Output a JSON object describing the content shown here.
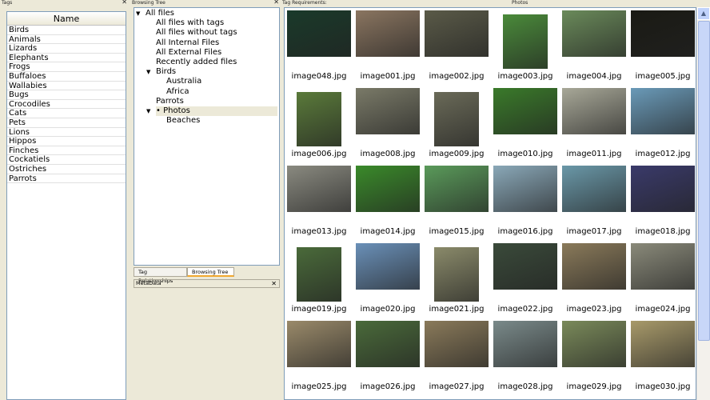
{
  "tags_panel": {
    "title": "Tags",
    "column_header": "Name",
    "items": [
      "Birds",
      "Animals",
      "Lizards",
      "Elephants",
      "Frogs",
      "Buffaloes",
      "Wallabies",
      "Bugs",
      "Crocodiles",
      "Cats",
      "Pets",
      "Lions",
      "Hippos",
      "Finches",
      "Cockatiels",
      "Ostriches",
      "Parrots"
    ]
  },
  "browse_panel": {
    "title": "Browsing Tree",
    "tree": [
      {
        "label": "All files",
        "level": 0,
        "expanded": true
      },
      {
        "label": "All files with tags",
        "level": 1
      },
      {
        "label": "All files without tags",
        "level": 1
      },
      {
        "label": "All Internal Files",
        "level": 1
      },
      {
        "label": "All External Files",
        "level": 1
      },
      {
        "label": "Recently added files",
        "level": 1
      },
      {
        "label": "Birds",
        "level": 1,
        "expanded": true
      },
      {
        "label": "Australia",
        "level": 2
      },
      {
        "label": "Africa",
        "level": 2
      },
      {
        "label": "Parrots",
        "level": 1
      },
      {
        "label": "• Photos",
        "level": 1,
        "expanded": true,
        "selected": true
      },
      {
        "label": "Beaches",
        "level": 2
      }
    ],
    "tabs": [
      "Tag Relationships",
      "Browsing Tree"
    ],
    "active_tab": "Browsing Tree"
  },
  "metadata_panel": {
    "title": "MetaData"
  },
  "photos_panel": {
    "title_left": "Tag Requirements:",
    "title_center": "Photos",
    "images": [
      {
        "name": "image048.jpg",
        "color": "#1a3a2a"
      },
      {
        "name": "image001.jpg",
        "color": "#8a7560"
      },
      {
        "name": "image002.jpg",
        "color": "#5a5a48"
      },
      {
        "name": "image003.jpg",
        "color": "#4a8a3a",
        "portrait": true
      },
      {
        "name": "image004.jpg",
        "color": "#6a8a5a"
      },
      {
        "name": "image005.jpg",
        "color": "#1a1a14"
      },
      {
        "name": "image006.jpg",
        "color": "#5a7a3a",
        "portrait": true
      },
      {
        "name": "image008.jpg",
        "color": "#7a7a68"
      },
      {
        "name": "image009.jpg",
        "color": "#6a6a58",
        "portrait": true
      },
      {
        "name": "image010.jpg",
        "color": "#3a7a2a"
      },
      {
        "name": "image011.jpg",
        "color": "#a8a898"
      },
      {
        "name": "image012.jpg",
        "color": "#6a9ab8"
      },
      {
        "name": "image013.jpg",
        "color": "#8a8a80"
      },
      {
        "name": "image014.jpg",
        "color": "#3a8a2a"
      },
      {
        "name": "image015.jpg",
        "color": "#5a9a5a"
      },
      {
        "name": "image016.jpg",
        "color": "#8aa8b8"
      },
      {
        "name": "image017.jpg",
        "color": "#6a98a8"
      },
      {
        "name": "image018.jpg",
        "color": "#3a3a6a"
      },
      {
        "name": "image019.jpg",
        "color": "#4a6a3a",
        "portrait": true
      },
      {
        "name": "image020.jpg",
        "color": "#6a90b8"
      },
      {
        "name": "image021.jpg",
        "color": "#8a8a6a",
        "portrait": true
      },
      {
        "name": "image022.jpg",
        "color": "#3a4a3a"
      },
      {
        "name": "image023.jpg",
        "color": "#8a7a5a"
      },
      {
        "name": "image024.jpg",
        "color": "#8a8a7a"
      },
      {
        "name": "image025.jpg",
        "color": "#9a8a6a"
      },
      {
        "name": "image026.jpg",
        "color": "#4a6a3a"
      },
      {
        "name": "image027.jpg",
        "color": "#8a7a5a"
      },
      {
        "name": "image028.jpg",
        "color": "#7a8a8a"
      },
      {
        "name": "image029.jpg",
        "color": "#7a8a5a"
      },
      {
        "name": "image030.jpg",
        "color": "#a89a6a"
      }
    ]
  }
}
